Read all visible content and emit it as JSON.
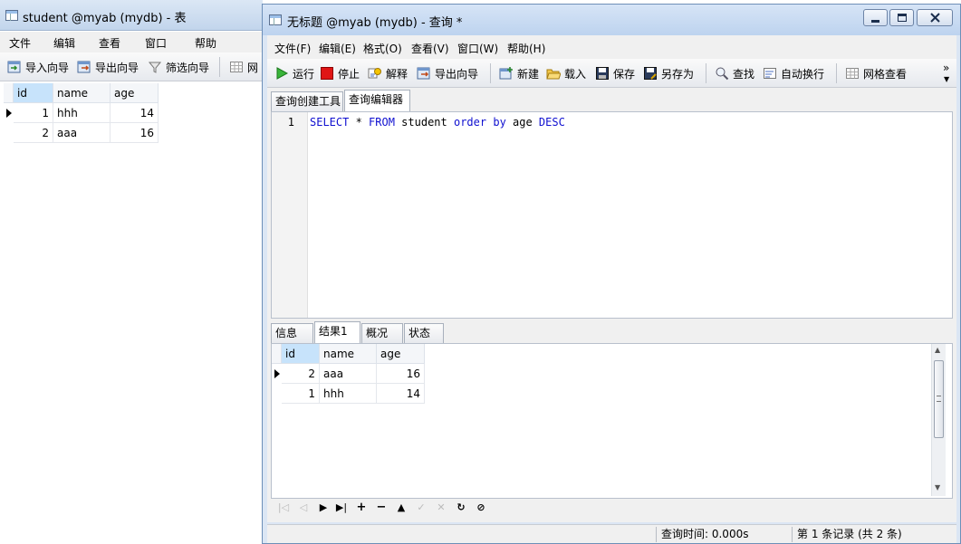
{
  "back_window": {
    "title": "student @myab (mydb) - 表",
    "menu": [
      "文件",
      "编辑",
      "查看",
      "窗口",
      "帮助"
    ],
    "toolbar": [
      "导入向导",
      "导出向导",
      "筛选向导",
      "网"
    ],
    "columns": [
      "id",
      "name",
      "age"
    ],
    "rows": [
      {
        "id": "1",
        "name": "hhh",
        "age": "14"
      },
      {
        "id": "2",
        "name": "aaa",
        "age": "16"
      }
    ]
  },
  "front_window": {
    "title": "无标题 @myab (mydb) - 查询 *",
    "menu": [
      "文件(F)",
      "编辑(E)",
      "格式(O)",
      "查看(V)",
      "窗口(W)",
      "帮助(H)"
    ],
    "toolbar": {
      "run": "运行",
      "stop": "停止",
      "explain": "解释",
      "export": "导出向导",
      "new": "新建",
      "load": "载入",
      "save": "保存",
      "save_as": "另存为",
      "find": "查找",
      "wrap": "自动换行",
      "grid_view": "网格查看",
      "more": "»"
    },
    "editor_tabs": [
      "查询创建工具",
      "查询编辑器"
    ],
    "editor": {
      "line_number": "1",
      "tokens": [
        {
          "t": "SELECT",
          "kw": true
        },
        {
          "t": " * ",
          "kw": false
        },
        {
          "t": "FROM",
          "kw": true
        },
        {
          "t": " student ",
          "kw": false
        },
        {
          "t": "order",
          "kw": true
        },
        {
          "t": " ",
          "kw": false
        },
        {
          "t": "by",
          "kw": true
        },
        {
          "t": " age ",
          "kw": false
        },
        {
          "t": "DESC",
          "kw": true
        }
      ]
    },
    "result_tabs": [
      "信息",
      "结果1",
      "概况",
      "状态"
    ],
    "columns": [
      "id",
      "name",
      "age"
    ],
    "rows": [
      {
        "id": "2",
        "name": "aaa",
        "age": "16"
      },
      {
        "id": "1",
        "name": "hhh",
        "age": "14"
      }
    ],
    "status": {
      "query_time": "查询时间: 0.000s",
      "record": "第 1 条记录 (共 2 条)"
    }
  },
  "colors": {
    "keyword": "#1010d0",
    "selected_header": "#c7e3fb",
    "title_bar": "#c2d5ec"
  }
}
